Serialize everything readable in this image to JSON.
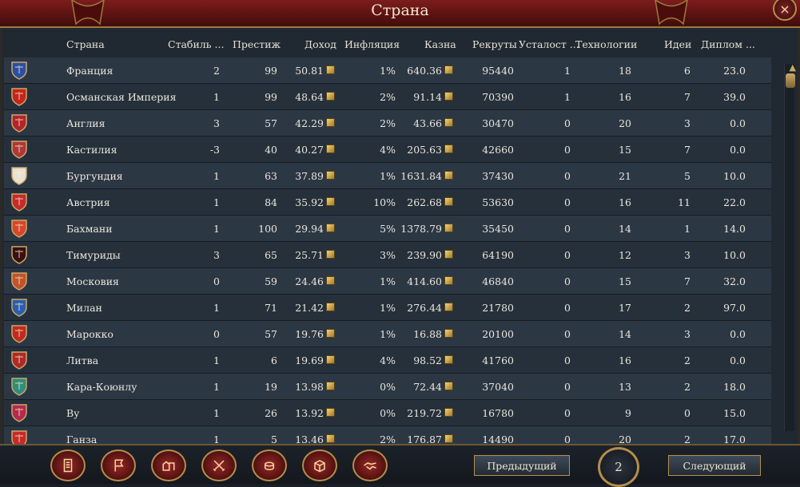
{
  "window": {
    "title": "Страна",
    "close_icon": "×"
  },
  "columns": [
    "Страна",
    "Стабиль ...",
    "Престиж",
    "Доход",
    "Инфляция",
    "Казна",
    "Рекруты",
    "Усталост ...",
    "Технологии",
    "Идеи",
    "Диплом ..."
  ],
  "rows": [
    {
      "name": "Франция",
      "stability": "2",
      "prestige": "99",
      "income": "50.81",
      "inflation": "1%",
      "treasury": "640.36",
      "manpower": "95440",
      "war_exhaustion": "1",
      "tech": "18",
      "ideas": "6",
      "diplo": "23.0",
      "flag": "#2b4fa6"
    },
    {
      "name": "Османская Империя",
      "stability": "1",
      "prestige": "99",
      "income": "48.64",
      "inflation": "2%",
      "treasury": "91.14",
      "manpower": "70390",
      "war_exhaustion": "1",
      "tech": "16",
      "ideas": "7",
      "diplo": "39.0",
      "flag": "#c4251d"
    },
    {
      "name": "Англия",
      "stability": "3",
      "prestige": "57",
      "income": "42.29",
      "inflation": "2%",
      "treasury": "43.66",
      "manpower": "30470",
      "war_exhaustion": "0",
      "tech": "20",
      "ideas": "3",
      "diplo": "0.0",
      "flag": "#b3242a"
    },
    {
      "name": "Кастилия",
      "stability": "-3",
      "prestige": "40",
      "income": "40.27",
      "inflation": "4%",
      "treasury": "205.63",
      "manpower": "42660",
      "war_exhaustion": "0",
      "tech": "15",
      "ideas": "7",
      "diplo": "0.0",
      "flag": "#b03838"
    },
    {
      "name": "Бургундия",
      "stability": "1",
      "prestige": "63",
      "income": "37.89",
      "inflation": "1%",
      "treasury": "1631.84",
      "manpower": "37430",
      "war_exhaustion": "0",
      "tech": "21",
      "ideas": "5",
      "diplo": "10.0",
      "flag": "#e8e2d2"
    },
    {
      "name": "Австрия",
      "stability": "1",
      "prestige": "84",
      "income": "35.92",
      "inflation": "10%",
      "treasury": "262.68",
      "manpower": "53630",
      "war_exhaustion": "0",
      "tech": "16",
      "ideas": "11",
      "diplo": "22.0",
      "flag": "#c62b2b"
    },
    {
      "name": "Бахмани",
      "stability": "1",
      "prestige": "100",
      "income": "29.94",
      "inflation": "5%",
      "treasury": "1378.79",
      "manpower": "35450",
      "war_exhaustion": "0",
      "tech": "14",
      "ideas": "1",
      "diplo": "14.0",
      "flag": "#d5472a"
    },
    {
      "name": "Тимуриды",
      "stability": "3",
      "prestige": "65",
      "income": "25.71",
      "inflation": "3%",
      "treasury": "239.90",
      "manpower": "64190",
      "war_exhaustion": "0",
      "tech": "12",
      "ideas": "3",
      "diplo": "10.0",
      "flag": "#3a1010"
    },
    {
      "name": "Московия",
      "stability": "0",
      "prestige": "59",
      "income": "24.46",
      "inflation": "1%",
      "treasury": "414.60",
      "manpower": "46840",
      "war_exhaustion": "0",
      "tech": "15",
      "ideas": "7",
      "diplo": "32.0",
      "flag": "#c2542c"
    },
    {
      "name": "Милан",
      "stability": "1",
      "prestige": "71",
      "income": "21.42",
      "inflation": "1%",
      "treasury": "276.44",
      "manpower": "21780",
      "war_exhaustion": "0",
      "tech": "17",
      "ideas": "2",
      "diplo": "97.0",
      "flag": "#2a5fb0"
    },
    {
      "name": "Марокко",
      "stability": "0",
      "prestige": "57",
      "income": "19.76",
      "inflation": "1%",
      "treasury": "16.88",
      "manpower": "20100",
      "war_exhaustion": "0",
      "tech": "14",
      "ideas": "3",
      "diplo": "0.0",
      "flag": "#c02a1f"
    },
    {
      "name": "Литва",
      "stability": "1",
      "prestige": "6",
      "income": "19.69",
      "inflation": "4%",
      "treasury": "98.52",
      "manpower": "41760",
      "war_exhaustion": "0",
      "tech": "16",
      "ideas": "2",
      "diplo": "0.0",
      "flag": "#b02a2a"
    },
    {
      "name": "Кара-Коюнлу",
      "stability": "1",
      "prestige": "19",
      "income": "13.98",
      "inflation": "0%",
      "treasury": "72.44",
      "manpower": "37040",
      "war_exhaustion": "0",
      "tech": "13",
      "ideas": "2",
      "diplo": "18.0",
      "flag": "#2f8d7a"
    },
    {
      "name": "Ву",
      "stability": "1",
      "prestige": "26",
      "income": "13.92",
      "inflation": "0%",
      "treasury": "219.72",
      "manpower": "16780",
      "war_exhaustion": "0",
      "tech": "9",
      "ideas": "0",
      "diplo": "15.0",
      "flag": "#b32a4e"
    },
    {
      "name": "Ганза",
      "stability": "1",
      "prestige": "5",
      "income": "13.46",
      "inflation": "2%",
      "treasury": "176.87",
      "manpower": "14490",
      "war_exhaustion": "0",
      "tech": "20",
      "ideas": "2",
      "diplo": "17.0",
      "flag": "#c72a2a"
    }
  ],
  "toolbar": [
    "ledger-icon",
    "flag-icon",
    "buildings-icon",
    "crossed-swords-icon",
    "coins-icon",
    "trade-goods-icon",
    "handshake-icon"
  ],
  "nav": {
    "prev_label": "Предыдущий",
    "next_label": "Следующий",
    "page": "2"
  },
  "colors": {
    "title_bar": "#6a1716",
    "gold_trim": "#b68d4c",
    "row_odd": "#2c3744",
    "row_even": "#25303b"
  }
}
